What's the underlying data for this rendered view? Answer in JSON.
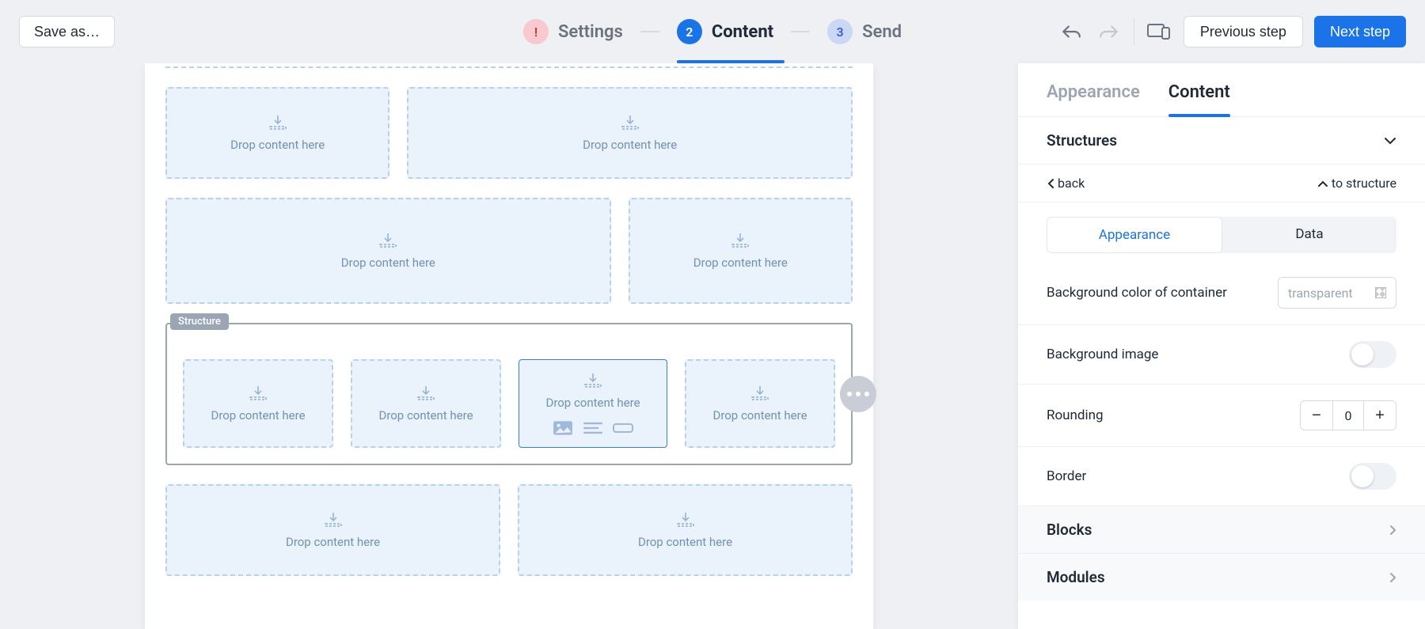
{
  "topbar": {
    "save_as": "Save as…",
    "steps": {
      "settings": {
        "badge": "!",
        "label": "Settings"
      },
      "content": {
        "badge": "2",
        "label": "Content"
      },
      "send": {
        "badge": "3",
        "label": "Send"
      }
    },
    "prev": "Previous step",
    "next": "Next step"
  },
  "canvas": {
    "drop_text": "Drop content here",
    "structure_tag": "Structure"
  },
  "sidebar": {
    "tabs": {
      "appearance": "Appearance",
      "content": "Content"
    },
    "structures": "Structures",
    "nav_back": "back",
    "nav_tostructure": "to structure",
    "seg_appearance": "Appearance",
    "seg_data": "Data",
    "bg_color_label": "Background color of container",
    "bg_color_value": "transparent",
    "bg_image_label": "Background image",
    "rounding_label": "Rounding",
    "rounding_value": "0",
    "border_label": "Border",
    "blocks": "Blocks",
    "modules": "Modules"
  }
}
